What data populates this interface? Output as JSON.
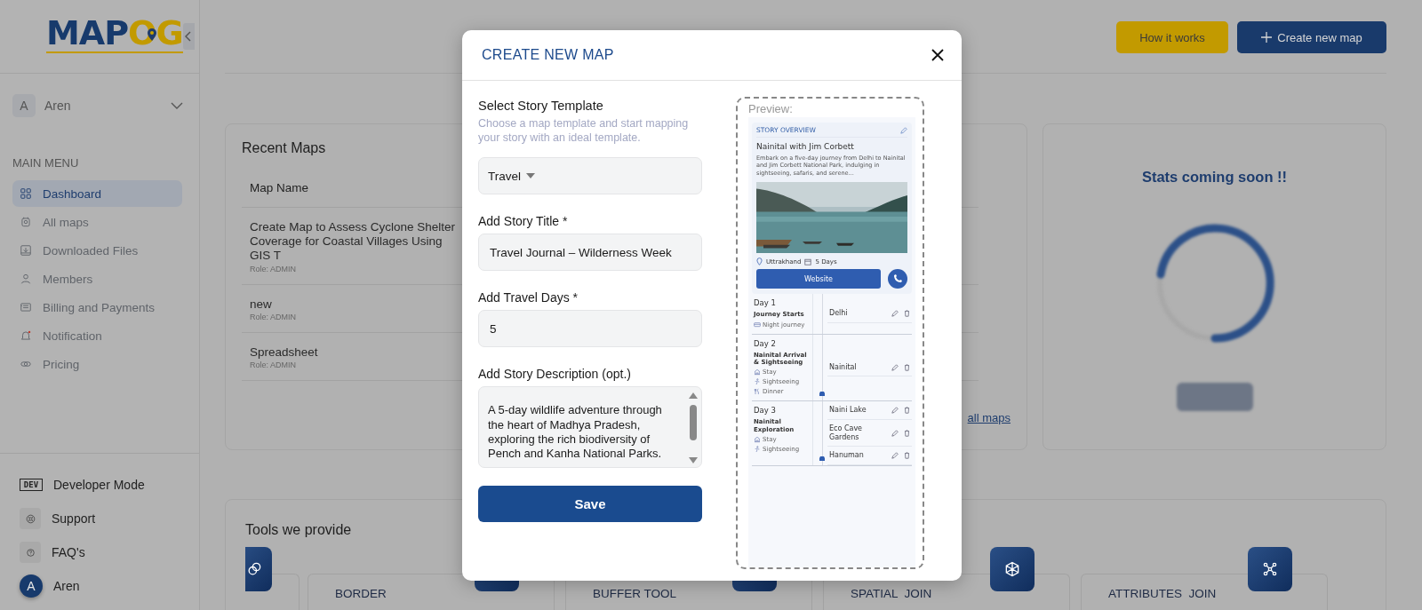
{
  "logo": {
    "part_a": "MAP",
    "part_b": "OG"
  },
  "sidebar": {
    "user": {
      "initial": "A",
      "name": "Aren"
    },
    "menu_heading": "MAIN MENU",
    "items": [
      {
        "label": "Dashboard",
        "selected": true
      },
      {
        "label": "All maps",
        "selected": false
      },
      {
        "label": "Downloaded Files",
        "selected": false
      },
      {
        "label": "Members",
        "selected": false
      },
      {
        "label": "Billing and Payments",
        "selected": false
      },
      {
        "label": "Notification",
        "selected": false
      },
      {
        "label": "Pricing",
        "selected": false
      }
    ],
    "developer_mode": {
      "badge": "DEV",
      "label": "Developer Mode"
    },
    "bottom_items": [
      {
        "label": "Support"
      },
      {
        "label": "FAQ's"
      }
    ],
    "profile": {
      "initial": "A",
      "name": "Aren"
    }
  },
  "header": {
    "buttons": [
      {
        "label": "How it works",
        "kind": "secondary"
      },
      {
        "label": "Create new map",
        "kind": "primary"
      }
    ]
  },
  "recent_maps": {
    "title": "Recent Maps",
    "column": "Map Name",
    "rows": [
      {
        "name": "Create Map to Assess Cyclone Shelter Coverage for Coastal Villages Using GIS T",
        "role": "Role: ADMIN"
      },
      {
        "name": "new",
        "role": "Role: ADMIN"
      },
      {
        "name": "Spreadsheet",
        "role": "Role: ADMIN"
      }
    ],
    "link": "all maps"
  },
  "stats": {
    "title": "Stats coming soon !!"
  },
  "tools": {
    "title": "Tools we provide",
    "items": [
      {
        "label": "BORDER"
      },
      {
        "label": "BUFFER TOOL"
      },
      {
        "label": "SPATIAL  JOIN"
      },
      {
        "label": "ATTRIBUTES  JOIN"
      }
    ]
  },
  "modal": {
    "title": "CREATE NEW MAP",
    "template": {
      "label": "Select Story Template",
      "hint": "Choose a map template and start mapping your story with an ideal template.",
      "value": "Travel"
    },
    "fields": [
      {
        "kind": "input",
        "label": "Add Story Title *",
        "value": "Travel Journal – Wilderness Week"
      },
      {
        "kind": "input",
        "label": "Add Travel Days *",
        "value": "5"
      },
      {
        "kind": "textarea",
        "label": "Add Story Description (opt.)",
        "value": "A 5-day wildlife adventure through the heart of Madhya Pradesh, exploring the rich biodiversity of Pench and Kanha National Parks."
      }
    ],
    "save": "Save",
    "preview": {
      "label": "Preview:",
      "overview": {
        "heading": "STORY OVERVIEW",
        "title": "Nainital with Jim Corbett",
        "text": "Embark on a five-day journey from Delhi to Nainital and Jim Corbett National Park, indulging in sightseeing, safaris, and serene...",
        "location": "Uttrakhand",
        "duration": "5 Days",
        "button": "Website"
      },
      "days": [
        {
          "day": "Day 1",
          "title": "Journey Starts",
          "activities": [
            "Night journey"
          ],
          "stops": [
            "Delhi"
          ]
        },
        {
          "day": "Day 2",
          "title": "Nainital Arrival & Sightseeing",
          "activities": [
            "Stay",
            "Sightseeing",
            "Dinner"
          ],
          "stops": [
            "Nainital"
          ]
        },
        {
          "day": "Day 3",
          "title": "Nainital Exploration",
          "activities": [
            "Stay",
            "Sightseeing"
          ],
          "stops": [
            "Naini Lake",
            "Eco Cave Gardens",
            "Hanuman"
          ]
        }
      ]
    }
  }
}
